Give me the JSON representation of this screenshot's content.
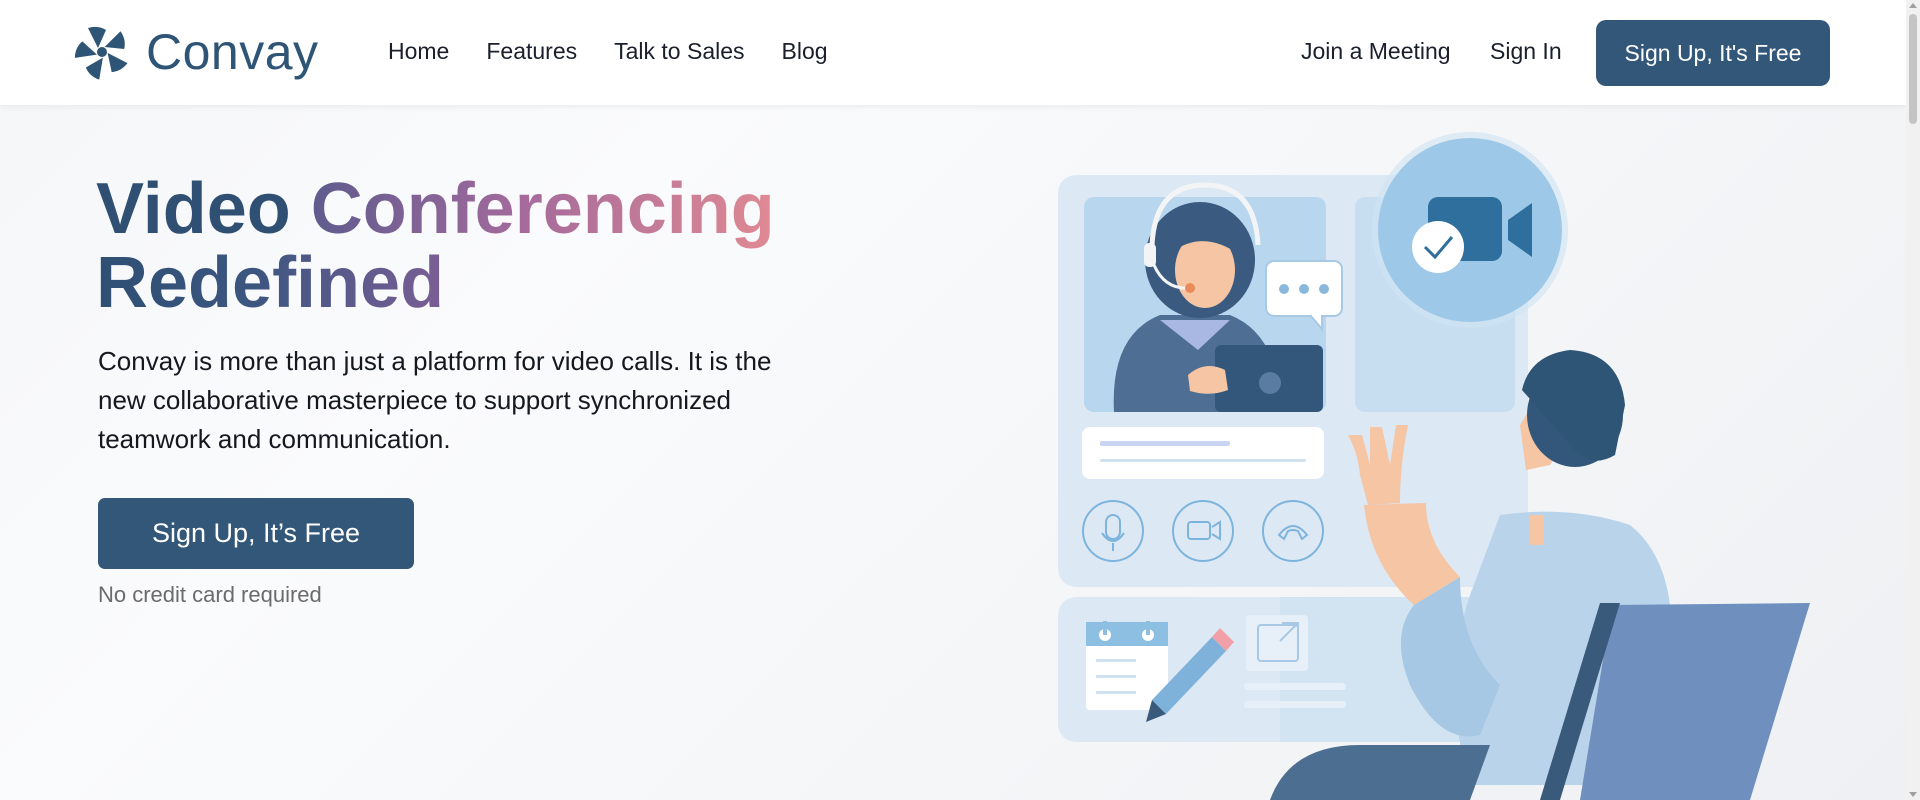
{
  "brand": {
    "name": "Convay",
    "color": "#2f5576"
  },
  "nav": {
    "items": [
      {
        "label": "Home"
      },
      {
        "label": "Features"
      },
      {
        "label": "Talk to Sales"
      },
      {
        "label": "Blog"
      }
    ],
    "join_label": "Join a Meeting",
    "signin_label": "Sign In",
    "cta_label": "Sign Up, It's Free"
  },
  "hero": {
    "title_part1": "Video ",
    "title_part2": "Conferencing",
    "title_line2": "Redefined",
    "description": "Convay is more than just a platform for video calls. It is the new collaborative masterpiece to support synchronized teamwork and communication.",
    "cta_label": "Sign Up, It’s Free",
    "note": "No credit card required"
  },
  "colors": {
    "accent": "#335778",
    "title": "#2f4f73",
    "gradient_start": "#5e5b8e",
    "gradient_end": "#e08a93"
  },
  "illustration": {
    "icons": [
      "headset-person",
      "video-camera-icon",
      "check-icon",
      "chat-bubble-icon",
      "microphone-icon",
      "camera-icon",
      "phone-hangup-icon",
      "calendar-icon",
      "pencil-icon",
      "external-link-icon",
      "waving-man"
    ]
  }
}
